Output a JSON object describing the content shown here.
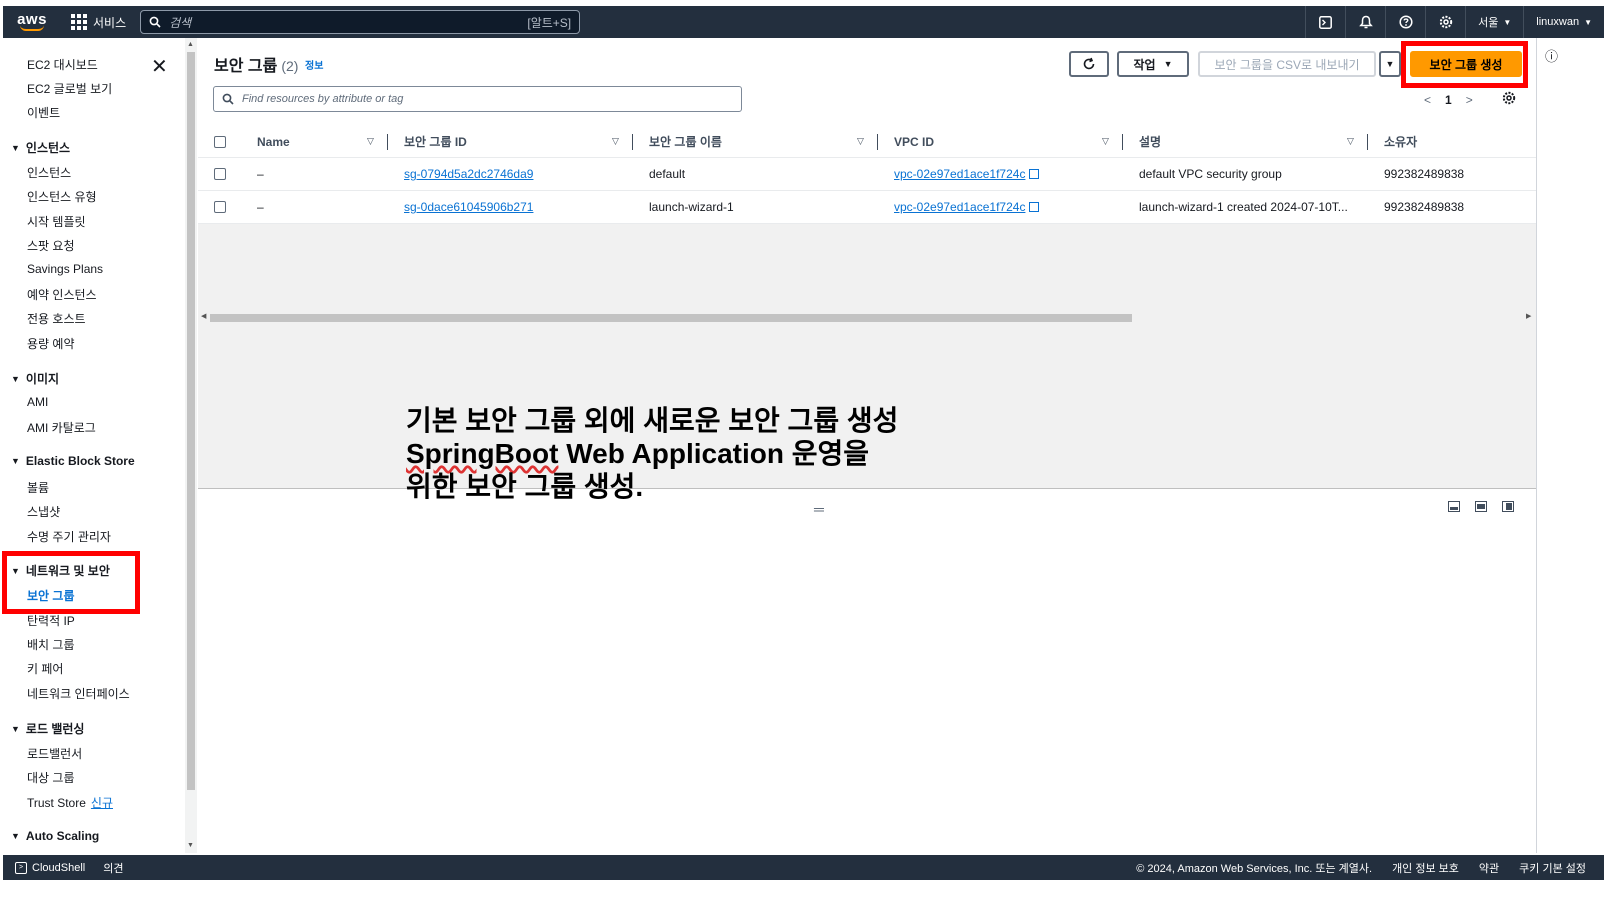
{
  "topnav": {
    "logo": "aws",
    "services": "서비스",
    "search_placeholder": "검색",
    "search_shortcut": "[알트+S]",
    "region": "서울",
    "user": "linuxwan"
  },
  "sidebar": {
    "top": [
      "EC2 대시보드",
      "EC2 글로벌 보기",
      "이벤트"
    ],
    "sections": [
      {
        "title": "인스턴스",
        "items": [
          "인스턴스",
          "인스턴스 유형",
          "시작 템플릿",
          "스팟 요청",
          "Savings Plans",
          "예약 인스턴스",
          "전용 호스트",
          "용량 예약"
        ]
      },
      {
        "title": "이미지",
        "items": [
          "AMI",
          "AMI 카탈로그"
        ]
      },
      {
        "title": "Elastic Block Store",
        "items": [
          "볼륨",
          "스냅샷",
          "수명 주기 관리자"
        ]
      },
      {
        "title": "네트워크 및 보안",
        "items": [
          "보안 그룹",
          "탄력적 IP",
          "배치 그룹",
          "키 페어",
          "네트워크 인터페이스"
        ]
      },
      {
        "title": "로드 밸런싱",
        "items": [
          "로드밸런서",
          "대상 그룹",
          "Trust Store"
        ]
      },
      {
        "title": "Auto Scaling",
        "items": []
      }
    ],
    "new_badge": "신규"
  },
  "main": {
    "title": "보안 그룹",
    "count": "(2)",
    "info": "정보",
    "actions_label": "작업",
    "export_label": "보안 그룹을 CSV로 내보내기",
    "create_label": "보안 그룹 생성",
    "filter_placeholder": "Find resources by attribute or tag",
    "page": "1"
  },
  "table": {
    "columns": [
      "Name",
      "보안 그룹 ID",
      "보안 그룹 이름",
      "VPC ID",
      "설명",
      "소유자"
    ],
    "rows": [
      {
        "name": "–",
        "sg_id": "sg-0794d5a2dc2746da9",
        "sg_name": "default",
        "vpc_id": "vpc-02e97ed1ace1f724c",
        "desc": "default VPC security group",
        "owner": "992382489838"
      },
      {
        "name": "–",
        "sg_id": "sg-0dace61045906b271",
        "sg_name": "launch-wizard-1",
        "vpc_id": "vpc-02e97ed1ace1f724c",
        "desc": "launch-wizard-1 created 2024-07-10T...",
        "owner": "992382489838"
      }
    ]
  },
  "annotation": {
    "line1": "기본 보안 그룹 외에 새로운 보안 그룹 생성",
    "line2a": "SpringBoot",
    "line2b": " Web Application 운영을",
    "line3": "위한 보안 그룹 생성."
  },
  "footer": {
    "cloudshell": "CloudShell",
    "feedback": "의견",
    "copyright": "© 2024, Amazon Web Services, Inc. 또는 계열사.",
    "privacy": "개인 정보 보호",
    "terms": "약관",
    "cookies": "쿠키 기본 설정"
  },
  "colors": {
    "highlight": "#ff0000",
    "primary": "#ff9900",
    "link": "#0972d3",
    "nav": "#232f3e"
  }
}
